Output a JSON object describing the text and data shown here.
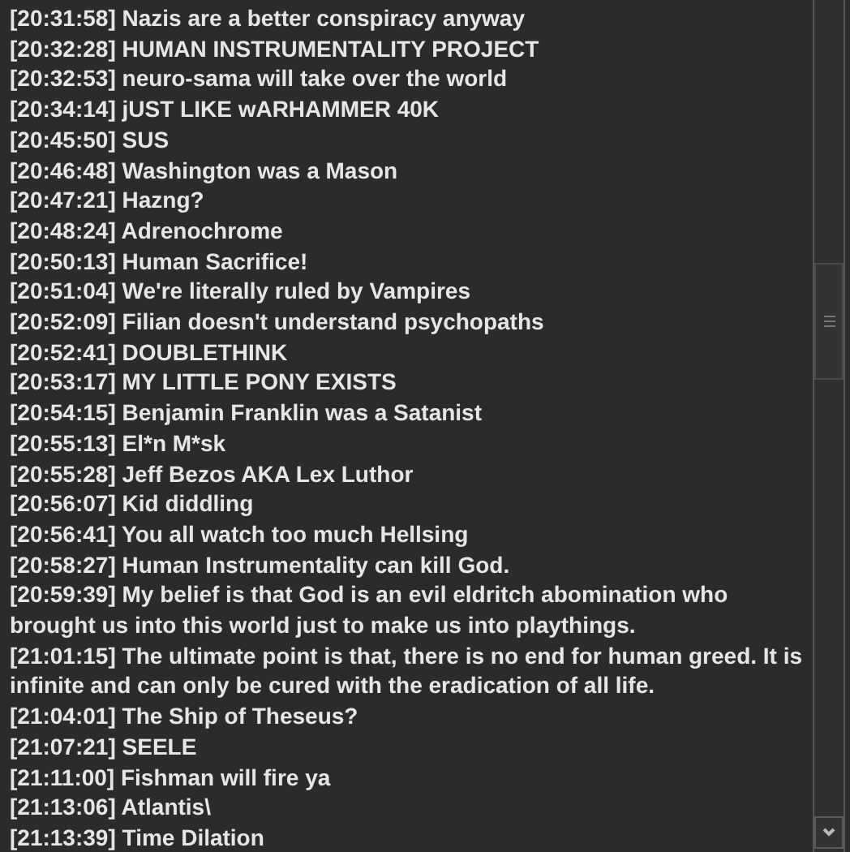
{
  "messages": [
    {
      "time": "[20:31:58]",
      "text": "Nazis are a better conspiracy anyway"
    },
    {
      "time": "[20:32:28]",
      "text": "HUMAN INSTRUMENTALITY PROJECT"
    },
    {
      "time": "[20:32:53]",
      "text": "neuro-sama will take over the world"
    },
    {
      "time": "[20:34:14]",
      "text": "jUST LIKE wARHAMMER 40K"
    },
    {
      "time": "[20:45:50]",
      "text": "SUS"
    },
    {
      "time": "[20:46:48]",
      "text": "Washington was a Mason"
    },
    {
      "time": "[20:47:21]",
      "text": "Hazng?"
    },
    {
      "time": "[20:48:24]",
      "text": "Adrenochrome"
    },
    {
      "time": "[20:50:13]",
      "text": "Human Sacrifice!"
    },
    {
      "time": "[20:51:04]",
      "text": "We're literally ruled by Vampires"
    },
    {
      "time": "[20:52:09]",
      "text": "Filian doesn't understand psychopaths"
    },
    {
      "time": "[20:52:41]",
      "text": "DOUBLETHINK"
    },
    {
      "time": "[20:53:17]",
      "text": "MY LITTLE PONY EXISTS"
    },
    {
      "time": "[20:54:15]",
      "text": "Benjamin Franklin was a Satanist"
    },
    {
      "time": "[20:55:13]",
      "text": "El*n M*sk"
    },
    {
      "time": "[20:55:28]",
      "text": "Jeff Bezos AKA Lex Luthor"
    },
    {
      "time": "[20:56:07]",
      "text": "Kid diddling"
    },
    {
      "time": "[20:56:41]",
      "text": "You all watch too much Hellsing"
    },
    {
      "time": "[20:58:27]",
      "text": "Human Instrumentality can kill God."
    },
    {
      "time": "[20:59:39]",
      "text": "My belief is that God is an evil eldritch abomination who brought us into this world just to make us into playthings."
    },
    {
      "time": "[21:01:15]",
      "text": "The ultimate point is that, there is no end for human greed. It is infinite and can only be cured with the eradication of all life."
    },
    {
      "time": "[21:04:01]",
      "text": "The Ship of Theseus?"
    },
    {
      "time": "[21:07:21]",
      "text": "SEELE"
    },
    {
      "time": "[21:11:00]",
      "text": "Fishman will fire ya"
    },
    {
      "time": "[21:13:06]",
      "text": "Atlantis\\"
    },
    {
      "time": "[21:13:39]",
      "text": "Time Dilation"
    }
  ]
}
